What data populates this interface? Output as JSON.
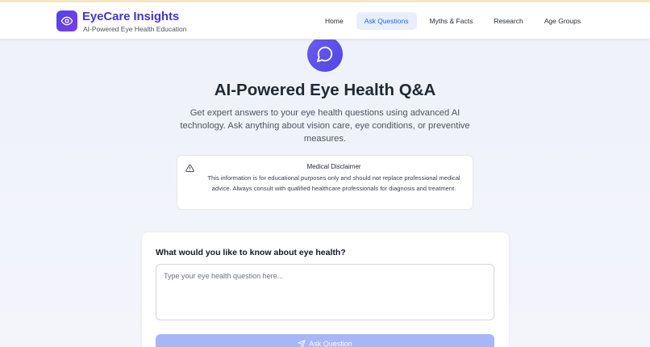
{
  "header": {
    "brand_title": "EyeCare Insights",
    "brand_subtitle": "AI-Powered Eye Health Education",
    "logo_icon": "eye-icon",
    "nav": [
      {
        "label": "Home",
        "active": false
      },
      {
        "label": "Ask Questions",
        "active": true
      },
      {
        "label": "Myths & Facts",
        "active": false
      },
      {
        "label": "Research",
        "active": false
      },
      {
        "label": "Age Groups",
        "active": false
      }
    ]
  },
  "hero": {
    "icon": "chat-bubble-icon",
    "title": "AI-Powered Eye Health Q&A",
    "description": "Get expert answers to your eye health questions using advanced AI technology. Ask anything about vision care, eye conditions, or preventive measures."
  },
  "disclaimer": {
    "icon": "warning-triangle-icon",
    "title": "Medical Disclaimer",
    "text": "This information is for educational purposes only and should not replace professional medical advice. Always consult with qualified healthcare professionals for diagnosis and treatment."
  },
  "question_form": {
    "label": "What would you like to know about eye health?",
    "placeholder": "Type your eye health question here...",
    "value": "",
    "submit_label": "Ask Question",
    "submit_icon": "send-icon"
  },
  "colors": {
    "brand": "#4338ca",
    "accent_gradient_start": "#4f46e5",
    "accent_gradient_end": "#7c3aed",
    "nav_active_bg": "#e8eefc",
    "nav_active_text": "#2563eb",
    "button_disabled": "#a7b6f5"
  }
}
